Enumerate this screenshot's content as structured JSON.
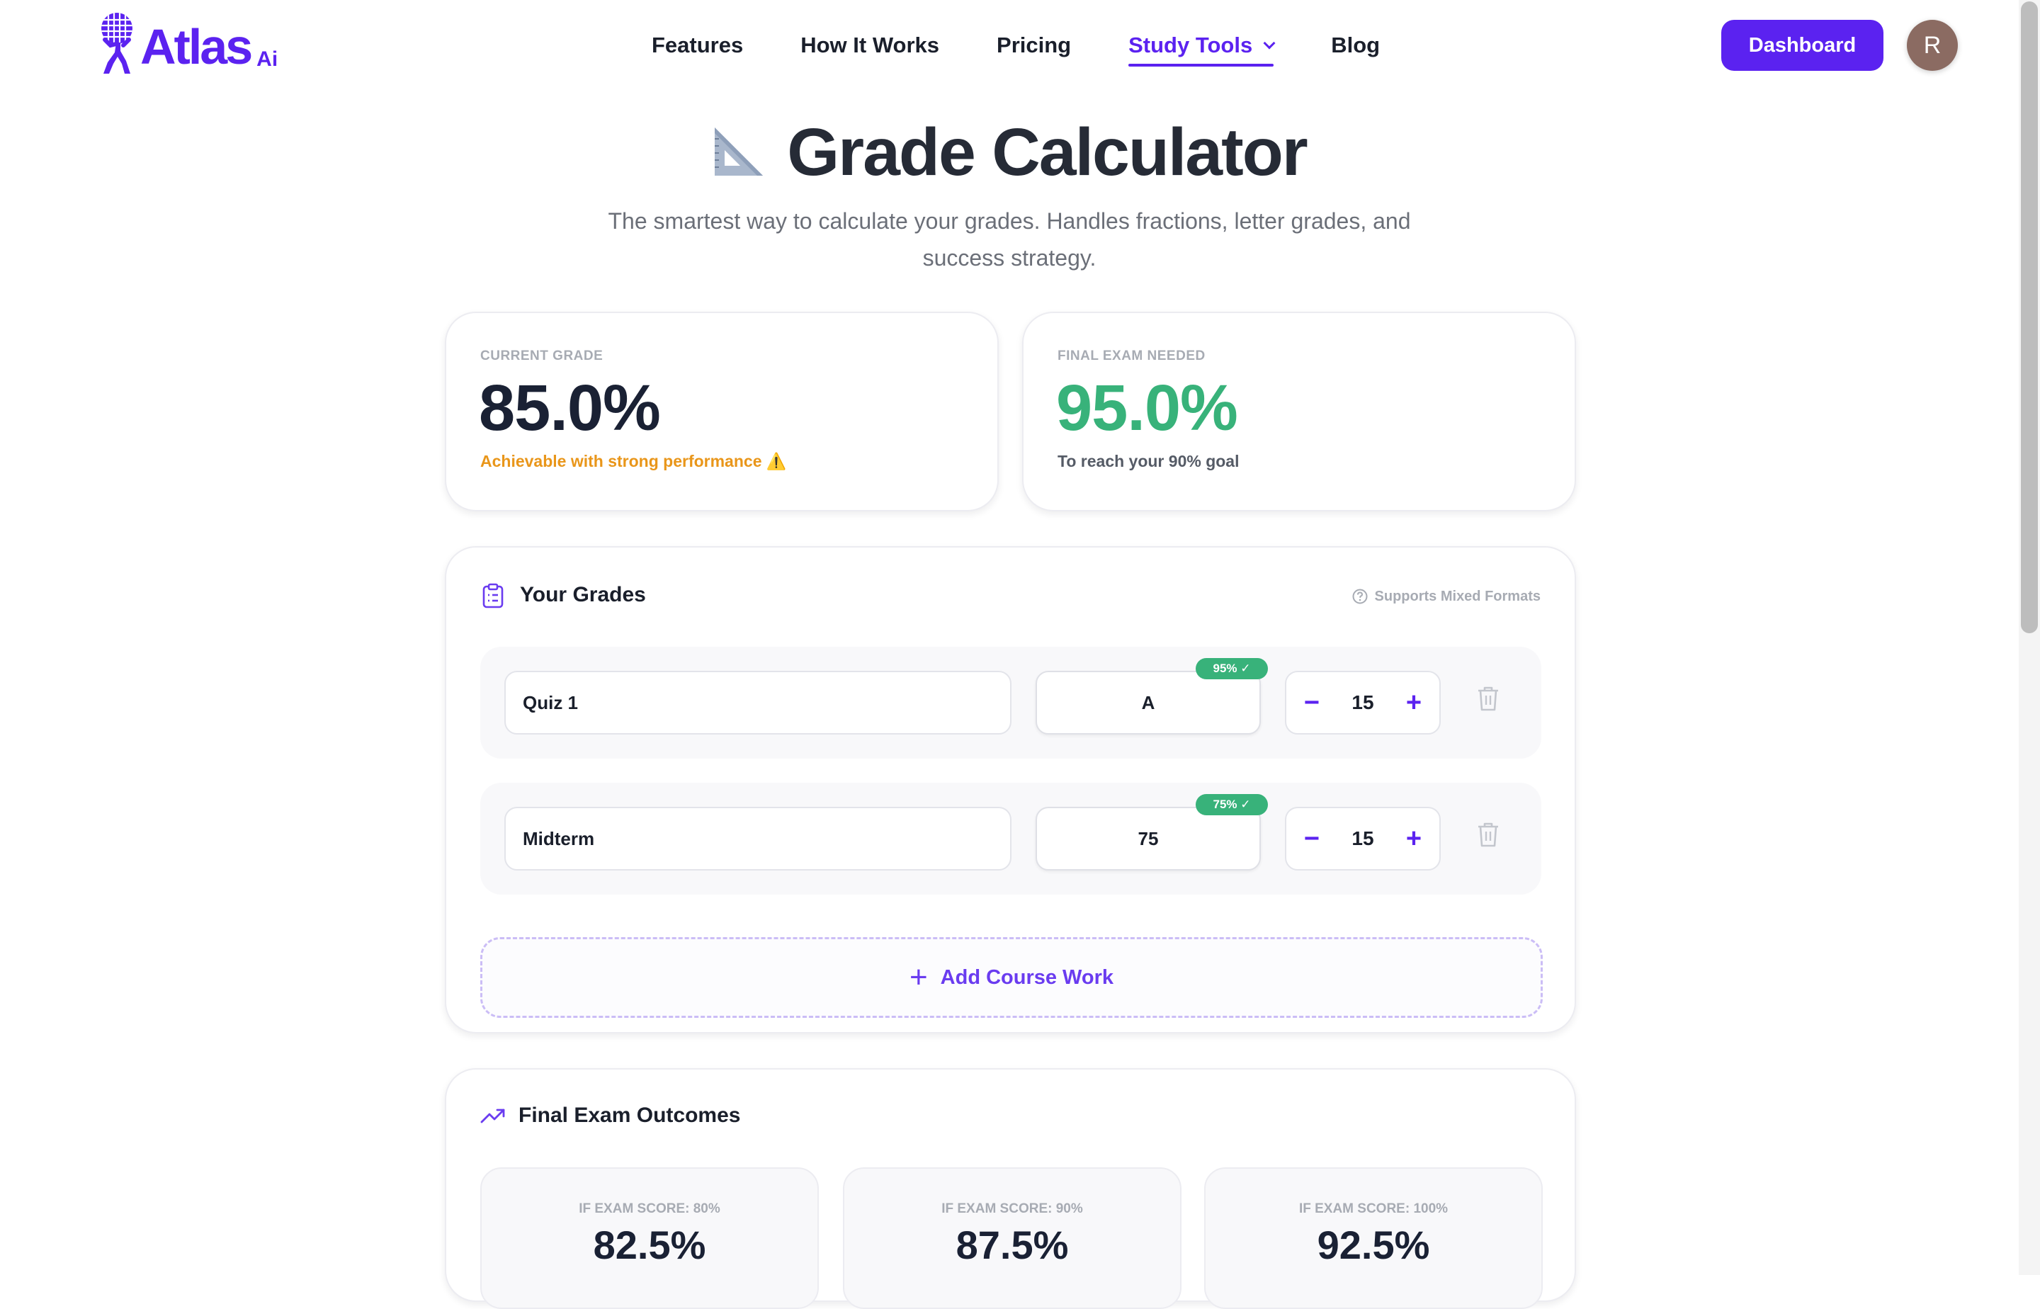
{
  "nav": {
    "logo_text": "Atlas",
    "logo_suffix": "Ai",
    "links": [
      {
        "label": "Features"
      },
      {
        "label": "How It Works"
      },
      {
        "label": "Pricing"
      },
      {
        "label": "Study Tools",
        "active": true
      },
      {
        "label": "Blog"
      }
    ],
    "dashboard_label": "Dashboard",
    "avatar_initial": "R"
  },
  "hero": {
    "title": "Grade Calculator",
    "title_icon": "set-square-icon",
    "subtitle": "The smartest way to calculate your grades. Handles fractions, letter grades, and success strategy."
  },
  "stats": {
    "current": {
      "label": "CURRENT GRADE",
      "value": "85.0%",
      "note": "Achievable with strong performance ⚠️"
    },
    "final_needed": {
      "label": "FINAL EXAM NEEDED",
      "value": "95.0%",
      "note": "To reach your 90% goal"
    }
  },
  "grades": {
    "title": "Your Grades",
    "formats_note": "Supports Mixed Formats",
    "rows": [
      {
        "name": "Quiz 1",
        "score": "A",
        "badge": "95% ✓",
        "weight": "15"
      },
      {
        "name": "Midterm",
        "score": "75",
        "badge": "75% ✓",
        "weight": "15"
      }
    ],
    "add_label": "Add Course Work"
  },
  "outcomes": {
    "title": "Final Exam Outcomes",
    "items": [
      {
        "label": "IF EXAM SCORE: 80%",
        "value": "82.5%"
      },
      {
        "label": "IF EXAM SCORE: 90%",
        "value": "87.5%"
      },
      {
        "label": "IF EXAM SCORE: 100%",
        "value": "92.5%"
      }
    ]
  },
  "colors": {
    "brand": "#5b22f0",
    "success": "#38b27a",
    "warning": "#e9961a",
    "text_dark": "#1a2134"
  }
}
